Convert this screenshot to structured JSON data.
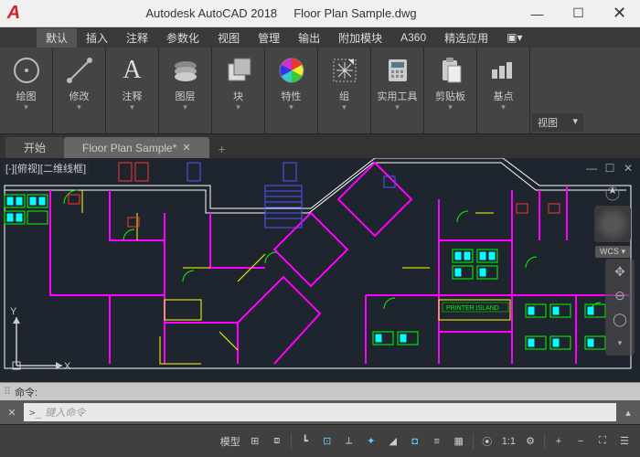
{
  "title": {
    "app": "Autodesk AutoCAD 2018",
    "file": "Floor Plan Sample.dwg"
  },
  "win": {
    "min": "—",
    "max": "☐",
    "close": "✕"
  },
  "menu": {
    "items": [
      "默认",
      "插入",
      "注释",
      "参数化",
      "视图",
      "管理",
      "输出",
      "附加模块",
      "A360",
      "精选应用"
    ],
    "active": 0
  },
  "ribbon": {
    "panels": [
      {
        "label": "绘图",
        "icon": "draw"
      },
      {
        "label": "修改",
        "icon": "modify"
      },
      {
        "label": "注释",
        "icon": "text"
      },
      {
        "label": "图层",
        "icon": "layers"
      },
      {
        "label": "块",
        "icon": "block"
      },
      {
        "label": "特性",
        "icon": "properties"
      },
      {
        "label": "组",
        "icon": "group"
      },
      {
        "label": "实用工具",
        "icon": "utilities"
      },
      {
        "label": "剪贴板",
        "icon": "clipboard"
      },
      {
        "label": "基点",
        "icon": "base"
      }
    ],
    "view": "视图"
  },
  "tabs": {
    "home": "开始",
    "active": "Floor Plan Sample*",
    "add": "+"
  },
  "viewport": {
    "label": "[-][俯视][二维线框]",
    "wcs": "WCS",
    "annotation": "PRINTER ISLAND"
  },
  "cmd": {
    "label": "命令:",
    "prompt": ">_",
    "placeholder": "键入命令"
  },
  "status": {
    "model": "模型",
    "scale": "1:1",
    "zoom_in": "+",
    "zoom_out": "−"
  },
  "axis": {
    "x": "X",
    "y": "Y"
  }
}
